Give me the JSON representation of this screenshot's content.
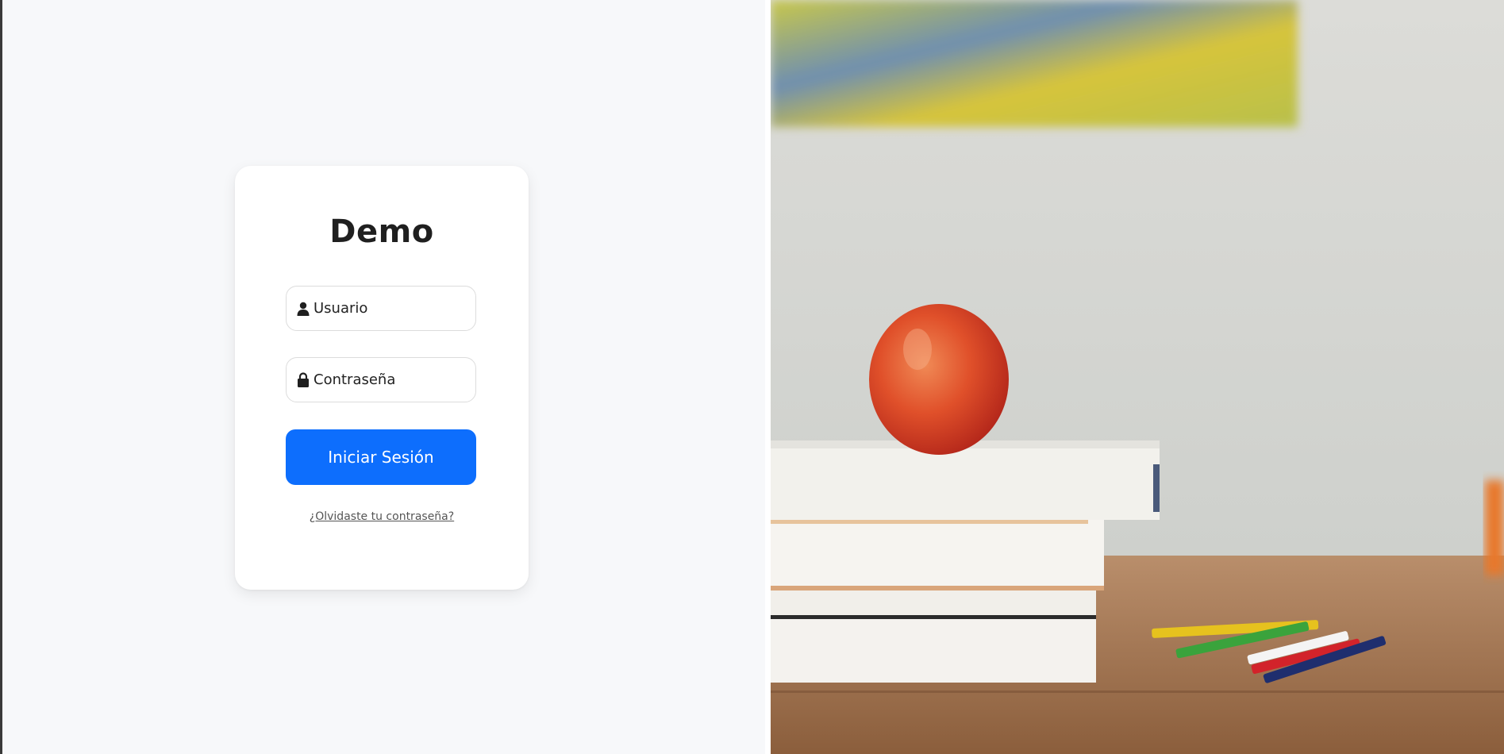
{
  "login": {
    "title": "Demo",
    "username_placeholder": "Usuario",
    "password_placeholder": "Contraseña",
    "submit_label": "Iniciar Sesión",
    "forgot_link": "¿Olvidaste tu contraseña?"
  },
  "colors": {
    "accent": "#0d6efd",
    "page_background": "#f7f8fa",
    "card_background": "#ffffff"
  },
  "icons": {
    "username": "user-icon",
    "password": "lock-icon"
  }
}
